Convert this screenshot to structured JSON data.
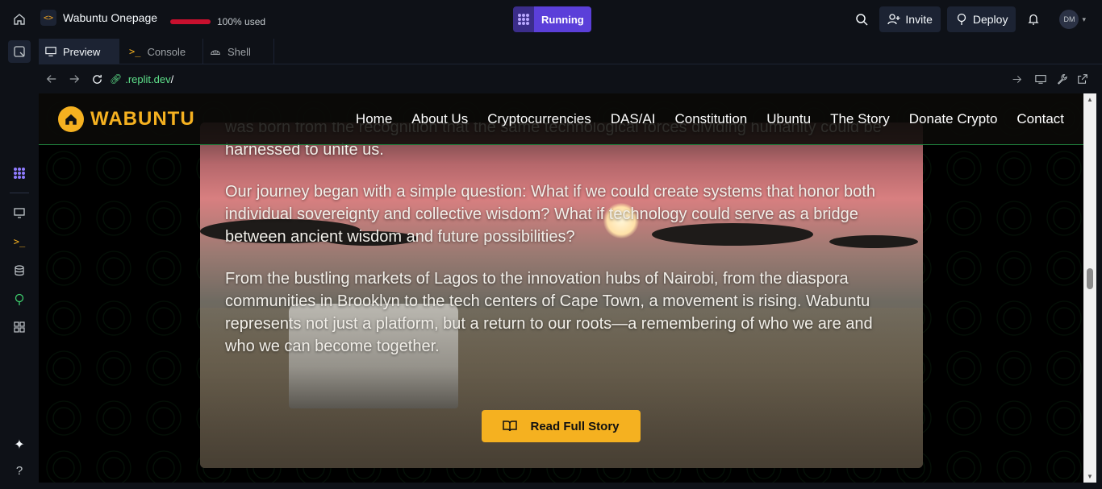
{
  "topbar": {
    "project_name": "Wabuntu Onepage",
    "usage_text": "100% used",
    "usage_fraction": 1.0,
    "run_label": "Running",
    "invite_label": "Invite",
    "deploy_label": "Deploy",
    "avatar_initials": "DM"
  },
  "tabs": [
    {
      "label": "Preview",
      "icon": "monitor-icon"
    },
    {
      "label": "Console",
      "icon": "terminal-icon"
    },
    {
      "label": "Shell",
      "icon": "shell-icon"
    }
  ],
  "urlbar": {
    "url_host": ".replit.dev",
    "url_path": "/"
  },
  "site": {
    "logo_text": "WABUNTU",
    "nav": [
      "Home",
      "About Us",
      "Cryptocurrencies",
      "DAS/AI",
      "Constitution",
      "Ubuntu",
      "The Story",
      "Donate Crypto",
      "Contact"
    ],
    "paragraphs": [
      "was born from the recognition that the same technological forces dividing humanity could be harnessed to unite us.",
      "Our journey began with a simple question: What if we could create systems that honor both individual sovereignty and collective wisdom? What if technology could serve as a bridge between ancient wisdom and future possibilities?",
      "From the bustling markets of Lagos to the innovation hubs of Nairobi, from the diaspora communities in Brooklyn to the tech centers of Cape Town, a movement is rising. Wabuntu represents not just a platform, but a return to our roots—a remembering of who we are and who we can become together."
    ],
    "read_button": "Read Full Story"
  },
  "colors": {
    "accent": "#f5b120",
    "run_purple": "#5b3fd9",
    "usage_red": "#c8102e",
    "url_green": "#5ee08a"
  }
}
